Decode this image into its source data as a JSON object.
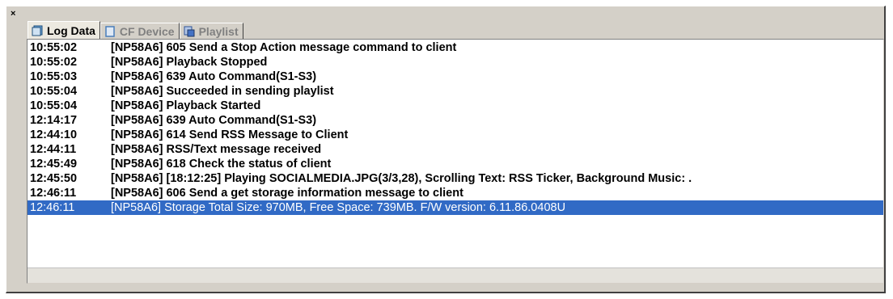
{
  "panel": {
    "close_label": "×"
  },
  "tabs": [
    {
      "label": "Log Data",
      "icon": "log-data-icon",
      "active": true
    },
    {
      "label": "CF Device",
      "icon": "cf-device-icon",
      "active": false
    },
    {
      "label": "Playlist",
      "icon": "playlist-icon",
      "active": false
    }
  ],
  "log": {
    "rows": [
      {
        "time": "10:55:02",
        "message": "[NP58A6] 605 Send a Stop Action message command to client",
        "selected": false
      },
      {
        "time": "10:55:02",
        "message": "[NP58A6] Playback Stopped",
        "selected": false
      },
      {
        "time": "10:55:03",
        "message": "[NP58A6] 639 Auto Command(S1-S3)",
        "selected": false
      },
      {
        "time": "10:55:04",
        "message": "[NP58A6] Succeeded in sending playlist",
        "selected": false
      },
      {
        "time": "10:55:04",
        "message": "[NP58A6] Playback Started",
        "selected": false
      },
      {
        "time": "12:14:17",
        "message": "[NP58A6] 639 Auto Command(S1-S3)",
        "selected": false
      },
      {
        "time": "12:44:10",
        "message": "[NP58A6] 614 Send RSS Message to Client",
        "selected": false
      },
      {
        "time": "12:44:11",
        "message": "[NP58A6] RSS/Text message received",
        "selected": false
      },
      {
        "time": "12:45:49",
        "message": "[NP58A6] 618 Check the status of client",
        "selected": false
      },
      {
        "time": "12:45:50",
        "message": "[NP58A6]  [18:12:25] Playing SOCIALMEDIA.JPG(3/3,28), Scrolling Text: RSS Ticker, Background Music:  .",
        "selected": false
      },
      {
        "time": "12:46:11",
        "message": "[NP58A6] 606 Send a get storage information message to client",
        "selected": false
      },
      {
        "time": "12:46:11",
        "message": "[NP58A6] Storage Total Size: 970MB, Free Space: 739MB. F/W version: 6.11.86.0408U",
        "selected": true
      }
    ]
  },
  "colors": {
    "selection": "#316ac5",
    "panel_bg": "#d4d0c8"
  }
}
